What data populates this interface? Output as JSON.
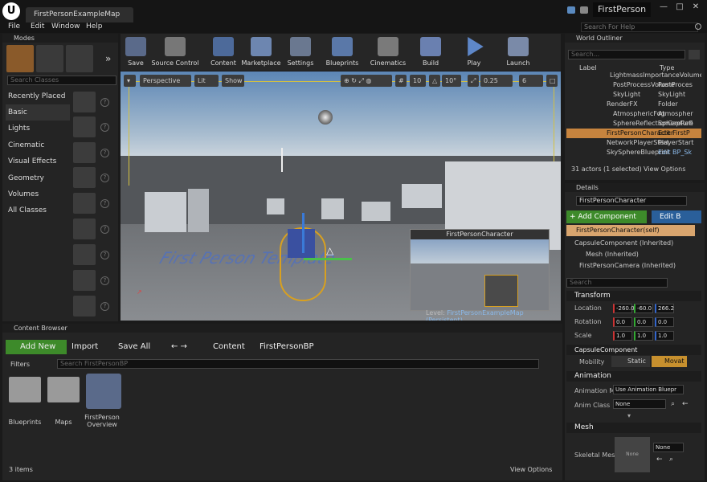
{
  "title_bar": {
    "logo": "U",
    "doc_tab": "FirstPersonExampleMap",
    "project": "FirstPerson",
    "minimize": "—",
    "maximize": "□",
    "close": "✕"
  },
  "menu": [
    "File",
    "Edit",
    "Window",
    "Help"
  ],
  "search_help": {
    "placeholder": "Search For Help"
  },
  "modes": {
    "title": "Modes",
    "search_placeholder": "Search Classes",
    "categories": [
      "Recently Placed",
      "Basic",
      "Lights",
      "Cinematic",
      "Visual Effects",
      "Geometry",
      "Volumes",
      "All Classes"
    ],
    "selected": "Basic"
  },
  "toolbar": [
    "Save",
    "Source Control",
    "Content",
    "Marketplace",
    "Settings",
    "Blueprints",
    "Cinematics",
    "Build",
    "Play",
    "Launch"
  ],
  "viewport": {
    "perspective": "Perspective",
    "lit": "Lit",
    "show": "Show",
    "grid_snap": "10",
    "rot_snap": "10°",
    "scale_snap": "0.25",
    "cam_speed": "6",
    "preview_title": "FirstPersonCharacter",
    "level_prefix": "Level:",
    "level_name": "FirstPersonExampleMap (Persistent)",
    "floor_text": "First Person Template"
  },
  "outliner": {
    "title": "World Outliner",
    "search_placeholder": "Search...",
    "col_label": "Label",
    "col_type": "Type",
    "rows": [
      {
        "label": "LightmassImportanceVolume",
        "type": "LightmassImp"
      },
      {
        "label": "PostProcessVolume",
        "type": "PostProces"
      },
      {
        "label": "SkyLight",
        "type": "SkyLight"
      },
      {
        "label": "RenderFX",
        "type": "Folder"
      },
      {
        "label": "AtmosphericFog",
        "type": "Atmospher"
      },
      {
        "label": "SphereReflectionCapture",
        "type": "SphereRefl"
      },
      {
        "label": "FirstPersonCharacter",
        "type": "Edit FirstP"
      },
      {
        "label": "NetworkPlayerStart",
        "type": "PlayerStart"
      },
      {
        "label": "SkySphereBlueprint",
        "type": "Edit BP_Sk"
      }
    ],
    "status": "31 actors (1 selected)",
    "view_options": "View Options"
  },
  "details": {
    "title": "Details",
    "name": "FirstPersonCharacter",
    "add_component": "+ Add Component",
    "edit": "Edit B",
    "self": "FirstPersonCharacter(self)",
    "components": [
      "CapsuleComponent (Inherited)",
      "Mesh (Inherited)",
      "FirstPersonCamera (Inherited)"
    ],
    "search_placeholder": "Search",
    "transform": "Transform",
    "location_label": "Location",
    "location": [
      "-260.0",
      "-60.0",
      "266.2"
    ],
    "rotation_label": "Rotation",
    "rotation": [
      "0.0",
      "0.0",
      "0.0"
    ],
    "scale_label": "Scale",
    "scale": [
      "1.0",
      "1.0",
      "1.0"
    ],
    "capsule": "CapsuleComponent",
    "mobility_label": "Mobility",
    "static": "Static",
    "movable": "Movat",
    "animation": "Animation",
    "anim_mode_label": "Animation M",
    "anim_mode": "Use Animation Bluepr",
    "anim_class_label": "Anim Class",
    "anim_class": "None",
    "mesh": "Mesh",
    "skeletal_label": "Skeletal Mes",
    "skeletal_thumb": "None",
    "skeletal_value": "None"
  },
  "content_browser": {
    "title": "Content Browser",
    "add_new": "Add New",
    "import": "Import",
    "save_all": "Save All",
    "path": [
      "Content",
      "FirstPersonBP"
    ],
    "filters": "Filters",
    "search_placeholder": "Search FirstPersonBP",
    "items": [
      "Blueprints",
      "Maps",
      "FirstPerson Overview"
    ],
    "count": "3 items",
    "view_options": "View Options"
  }
}
